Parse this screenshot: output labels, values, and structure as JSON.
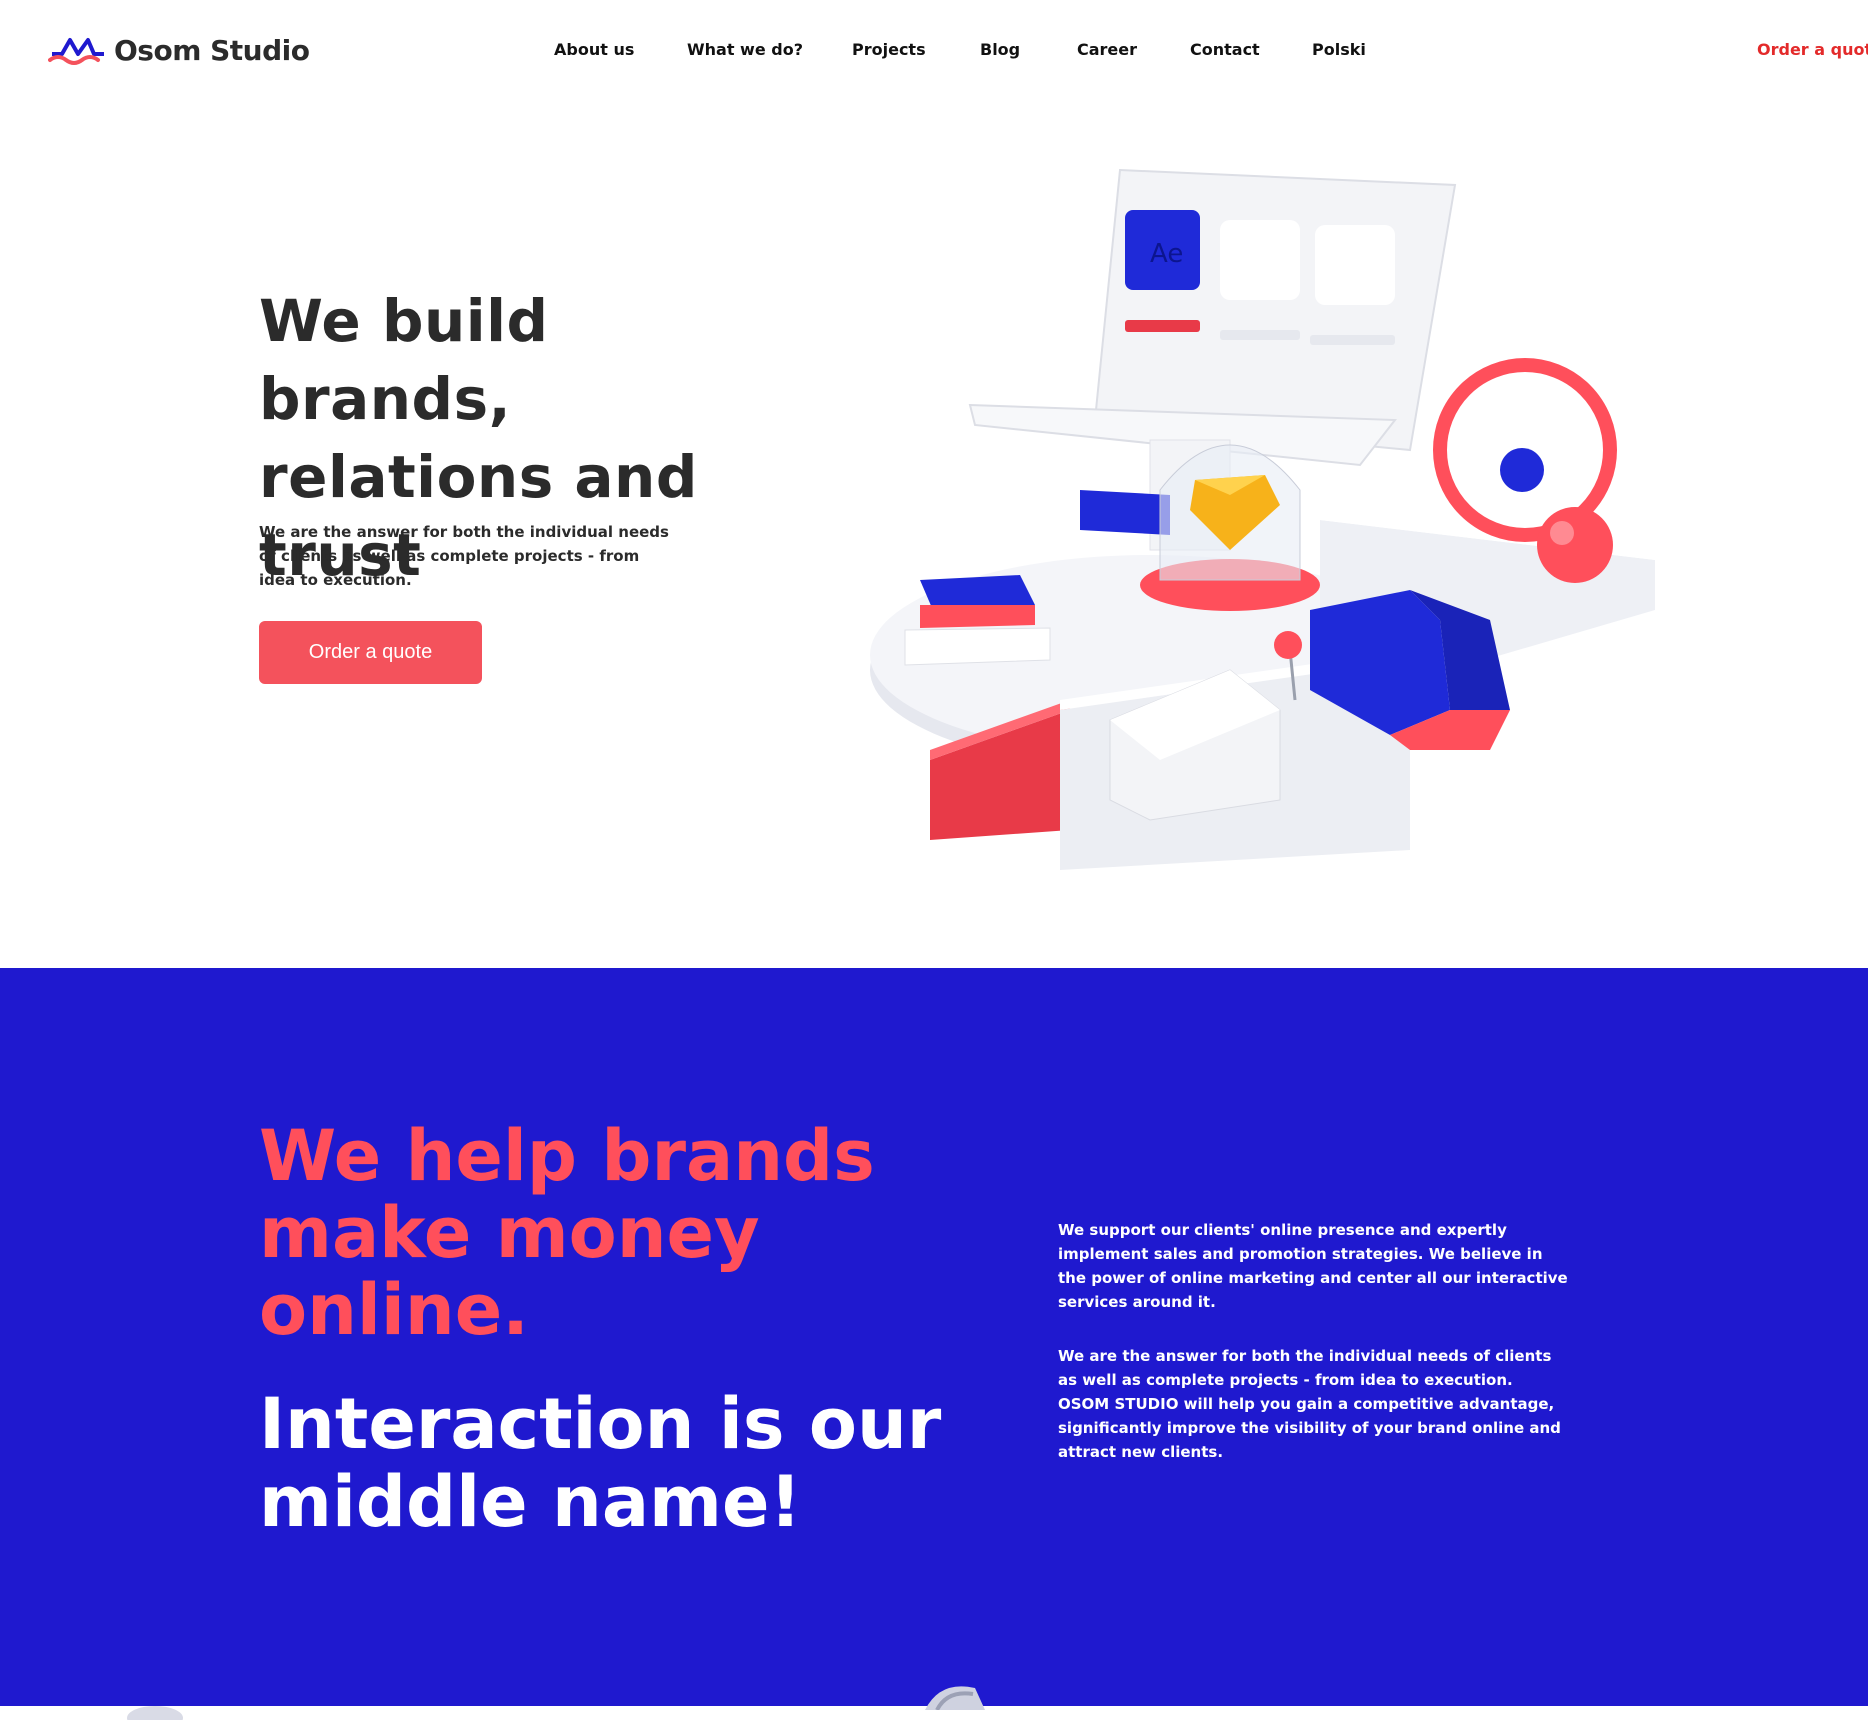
{
  "brand": {
    "name": "Osom Studio",
    "accent": "#f4525c",
    "blue": "#1f19cf",
    "red_link": "#e32a2a"
  },
  "nav": {
    "items": [
      {
        "label": "About us"
      },
      {
        "label": "What we do?"
      },
      {
        "label": "Projects"
      },
      {
        "label": "Blog"
      },
      {
        "label": "Career"
      },
      {
        "label": "Contact"
      },
      {
        "label": "Polski"
      }
    ],
    "cta": "Order a quote"
  },
  "hero": {
    "title": "We build brands, relations and trust",
    "subtitle": "We are the answer for both the individual needs of clients as well as complete projects - from idea to execution.",
    "button": "Order a quote",
    "illustration_icon": "3d-laptop-illustration-icon"
  },
  "section2": {
    "headline_red": "We help brands make money online.",
    "headline_white": "Interaction is our middle name!",
    "paragraph1": "We support our clients' online presence and expertly implement sales and promotion strategies. We believe in the power of online marketing and center all our interactive services around it.",
    "paragraph2": "We are the answer for both the individual needs of clients as well as complete projects - from idea to execution. OSOM STUDIO will help you gain a competitive advantage, significantly improve the visibility of your brand online and attract new clients."
  }
}
